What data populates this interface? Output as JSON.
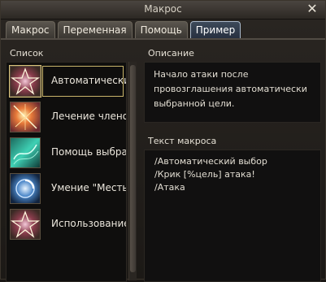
{
  "window": {
    "title": "Макрос",
    "close_symbol": "✕"
  },
  "tabs": [
    {
      "label": "Макрос",
      "active": false
    },
    {
      "label": "Переменная",
      "active": false
    },
    {
      "label": "Помощь",
      "active": false
    },
    {
      "label": "Пример",
      "active": true
    }
  ],
  "list": {
    "label": "Список",
    "items": [
      {
        "label": "Автоматический выбор",
        "icon": "star-burst-icon",
        "selected": true
      },
      {
        "label": "Лечение членов группы",
        "icon": "flare-icon",
        "selected": false
      },
      {
        "label": "Помощь выбранной цели",
        "icon": "teal-wave-icon",
        "selected": false
      },
      {
        "label": "Умение \"Месть\"",
        "icon": "vortex-icon",
        "selected": false
      },
      {
        "label": "Использование",
        "icon": "star-burst-icon",
        "selected": false
      }
    ]
  },
  "description": {
    "label": "Описание",
    "text": "Начало атаки после\nпровозглашения автоматически\nвыбранной цели."
  },
  "macro_text": {
    "label": "Текст макроса",
    "text": "/Автоматический выбор\n/Крик [%цель] атака!\n/Атака"
  },
  "colors": {
    "accent": "#c8b46a",
    "tab_active": "#273040",
    "panel_bg": "#111010"
  }
}
